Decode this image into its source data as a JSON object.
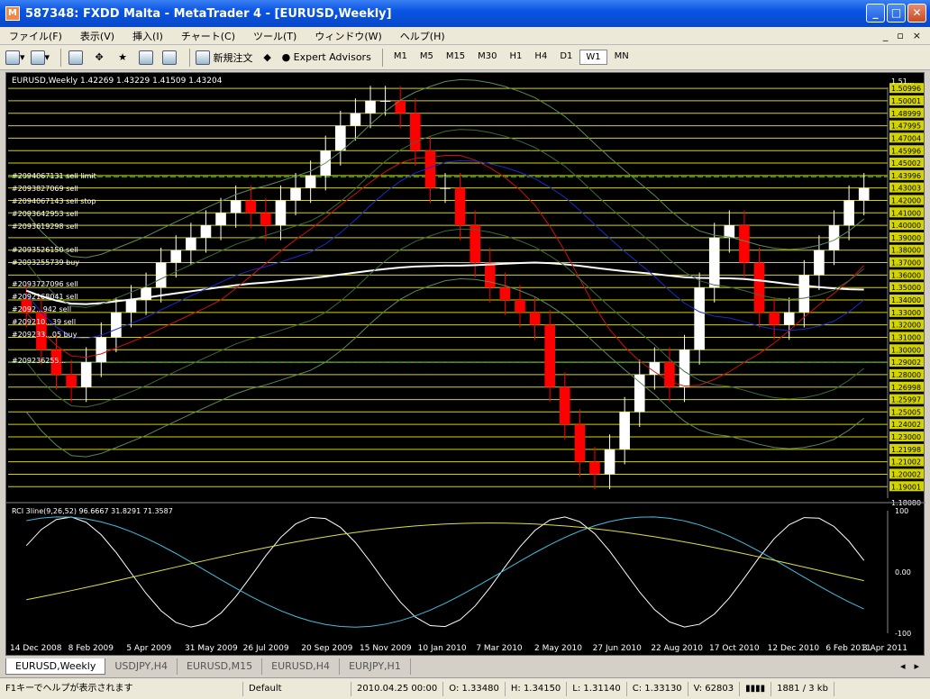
{
  "window": {
    "title": "587348: FXDD Malta - MetaTrader 4 - [EURUSD,Weekly]",
    "buttons": [
      "_",
      "□",
      "✕"
    ]
  },
  "menu": {
    "items": [
      "ファイル(F)",
      "表示(V)",
      "挿入(I)",
      "チャート(C)",
      "ツール(T)",
      "ウィンドウ(W)",
      "ヘルプ(H)"
    ],
    "mdi": [
      "_",
      "▫",
      "×"
    ]
  },
  "toolbar": {
    "new_order": "新規注文",
    "expert_advisors": "Expert Advisors",
    "timeframes": [
      "M1",
      "M5",
      "M15",
      "M30",
      "H1",
      "H4",
      "D1",
      "W1",
      "MN"
    ],
    "active_tf": "W1",
    "icons": [
      "new-chart-icon",
      "profiles-icon",
      "objects-icon",
      "crosshair-icon",
      "favorites-icon",
      "navigator-icon",
      "terminal-icon",
      "new-order-icon",
      "metaeditor-icon",
      "expert-advisors-icon"
    ]
  },
  "chart": {
    "header": "EURUSD,Weekly  1.42269 1.43229 1.41509 1.43204",
    "price_levels": [
      "1.50996",
      "1.50001",
      "1.48999",
      "1.47995",
      "1.47004",
      "1.45996",
      "1.45002",
      "1.43996",
      "1.43003",
      "1.42000",
      "1.41000",
      "1.40000",
      "1.39000",
      "1.38000",
      "1.37000",
      "1.36000",
      "1.35000",
      "1.34000",
      "1.33000",
      "1.32000",
      "1.31000",
      "1.30000",
      "1.29002",
      "1.28000",
      "1.26998",
      "1.25997",
      "1.25005",
      "1.24002",
      "1.23000",
      "1.21998",
      "1.21002",
      "1.20002",
      "1.19001"
    ],
    "axis_top": "1.51...",
    "axis_bottom": "1.18080",
    "current_price": "1.43204",
    "order_labels": [
      "#2094067131 sell limit",
      "#2093827069 sell",
      "#2094067143 sell stop",
      "#2093642953 sell",
      "#2093619298 sell",
      "#2093526150 sell",
      "#2093255739 buy",
      "#2093727096 sell",
      "#2092168041 sell",
      "#2092...942 sell",
      "#209210...39 sell",
      "#209233...05 buy",
      "#209236255..."
    ],
    "date_labels": [
      "14 Dec 2008",
      "8 Feb 2009",
      "5 Apr 2009",
      "31 May 2009",
      "26 Jul 2009",
      "20 Sep 2009",
      "15 Nov 2009",
      "10 Jan 2010",
      "7 Mar 2010",
      "2 May 2010",
      "27 Jun 2010",
      "22 Aug 2010",
      "17 Oct 2010",
      "12 Dec 2010",
      "6 Feb 2011",
      "3 Apr 2011"
    ],
    "rci_header": "RCI 3line(9,26,52) 96.6667 31.8291 71.3587",
    "rci_levels": [
      "100",
      "0.00",
      "-100"
    ],
    "colors": {
      "bull": "#ffffff",
      "bear": "#ff0000",
      "levels": "#d4d400",
      "bands": "#5a8a5a",
      "ma_white": "#ffffff",
      "ma_red": "#cc1111",
      "ma_blue": "#1a2ad0",
      "rci_short": "#ffffff",
      "rci_mid": "#40c0e0",
      "rci_long": "#e0e040"
    }
  },
  "chart_data": {
    "type": "candlestick",
    "series": [
      {
        "name": "EURUSD,Weekly",
        "close": [
          1.33,
          1.3,
          1.28,
          1.27,
          1.29,
          1.31,
          1.33,
          1.34,
          1.35,
          1.37,
          1.38,
          1.39,
          1.4,
          1.41,
          1.42,
          1.41,
          1.4,
          1.42,
          1.43,
          1.44,
          1.46,
          1.48,
          1.49,
          1.5,
          1.5,
          1.49,
          1.46,
          1.43,
          1.43,
          1.4,
          1.37,
          1.35,
          1.34,
          1.33,
          1.32,
          1.27,
          1.24,
          1.21,
          1.2,
          1.22,
          1.25,
          1.28,
          1.29,
          1.27,
          1.3,
          1.35,
          1.39,
          1.4,
          1.37,
          1.33,
          1.32,
          1.33,
          1.36,
          1.38,
          1.4,
          1.42,
          1.43
        ]
      }
    ],
    "ylim": [
      1.1808,
      1.5108
    ]
  },
  "tabs": {
    "items": [
      "EURUSD,Weekly",
      "USDJPY,H4",
      "EURUSD,M15",
      "EURUSD,H4",
      "EURJPY,H1"
    ],
    "active": "EURUSD,Weekly"
  },
  "status": {
    "help": "F1キーでヘルプが表示されます",
    "profile": "Default",
    "datetime": "2010.04.25 00:00",
    "open": "O: 1.33480",
    "high": "H: 1.34150",
    "low": "L: 1.31140",
    "close": "C: 1.33130",
    "volume": "V: 62803",
    "traffic": "1881 / 3 kb"
  }
}
